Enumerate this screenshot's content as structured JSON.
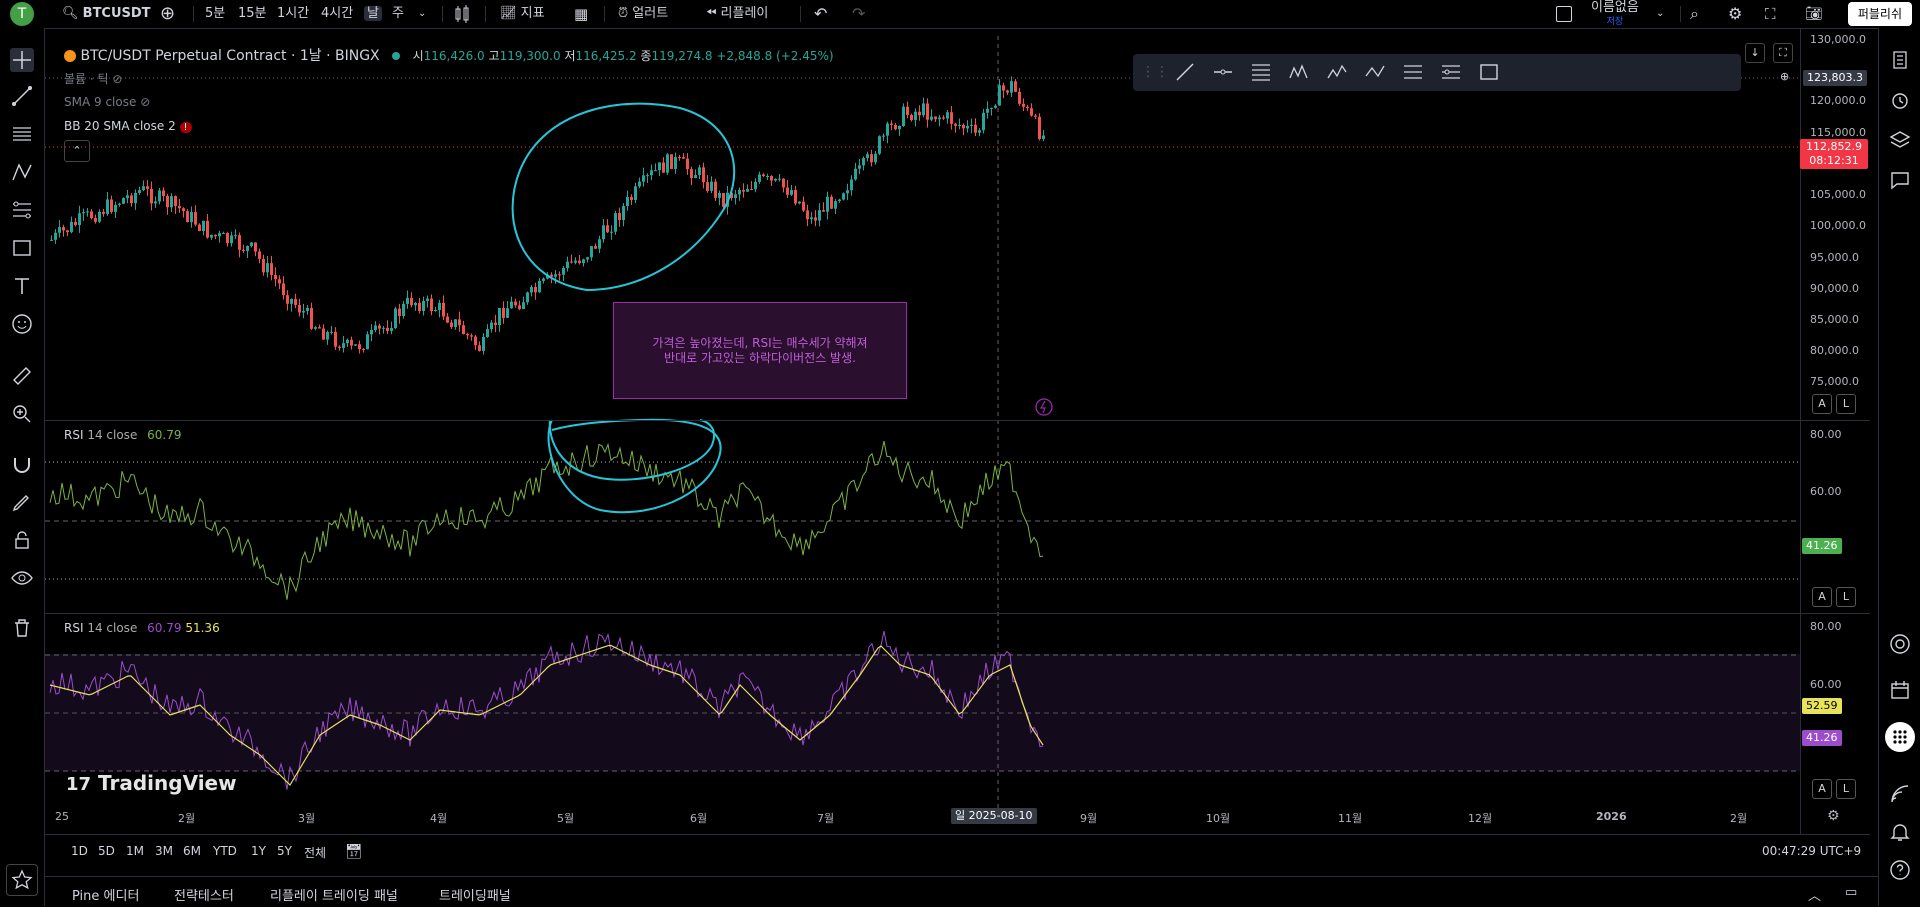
{
  "topbar": {
    "avatar_letter": "T",
    "symbol": "BTCUSDT",
    "intervals": [
      "5분",
      "15분",
      "1시간",
      "4시간",
      "날",
      "주"
    ],
    "indicators_label": "지표",
    "alert_label": "얼러트",
    "replay_label": "리플레이",
    "layout_name": "이름없음",
    "layout_sub": "저장",
    "publish_label": "퍼블리쉬"
  },
  "legend": {
    "title": "BTC/USDT Perpetual Contract · 1날 · BINGX",
    "open_label": "시",
    "open": "116,426.0",
    "high_label": "고",
    "high": "119,300.0",
    "low_label": "저",
    "low": "116,425.2",
    "close_label": "종",
    "close": "119,274.8",
    "change": "+2,848.8 (+2.45%)",
    "volume_label": "볼륨 · 틱",
    "sma": "SMA 9 close",
    "bb": "BB 20 SMA close 2"
  },
  "price_axis": [
    "130,000.0",
    "125,000.0",
    "120,000.0",
    "115,000.0",
    "105,000.0",
    "100,000.0",
    "95,000.0",
    "90,000.0",
    "85,000.0",
    "80,000.0",
    "75,000.0"
  ],
  "price_tags": {
    "crosshair": "123,803.3",
    "last": "112,852.9",
    "countdown": "08:12:31"
  },
  "annotation": {
    "line1": "가격은 높아졌는데, RSI는 매수세가 약해져",
    "line2": "반대로 가고있는 하락다이버전스 발생."
  },
  "rsi1": {
    "label": "RSI",
    "params": "14 close",
    "value": "60.79",
    "axis": [
      "80.00",
      "60.00"
    ],
    "tag": "41.26"
  },
  "rsi2": {
    "label": "RSI",
    "params": "14 close",
    "value": "60.79",
    "ma": "51.36",
    "axis": [
      "80.00",
      "60.00"
    ],
    "tag_ma": "52.59",
    "tag_rsi": "41.26"
  },
  "watermark": "TradingView",
  "time_axis": [
    "25",
    "2월",
    "3월",
    "4월",
    "5월",
    "6월",
    "7월",
    "9월",
    "10월",
    "11월",
    "12월",
    "2026",
    "2월"
  ],
  "crosshair_date": "일 2025-08-10",
  "ranges": [
    "1D",
    "5D",
    "1M",
    "3M",
    "6M",
    "YTD",
    "1Y",
    "5Y",
    "전체"
  ],
  "clock": "00:47:29 UTC+9",
  "bottom_tabs": [
    "Pine 에디터",
    "전략테스터",
    "리플레이 트레이딩 패널",
    "트레이딩패널"
  ],
  "colors": {
    "up": "#26a69a",
    "down": "#ef5350",
    "rsi": "#7cb342",
    "rsi2": "#9c4dcc",
    "rsi_ma": "#e8e35a",
    "drawing": "#26c6da",
    "last_price": "#f23645"
  }
}
